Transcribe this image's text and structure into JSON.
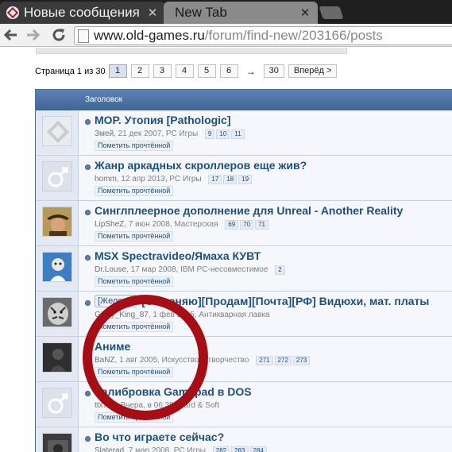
{
  "browser": {
    "tabs": [
      {
        "title": "Новые сообщения",
        "active": true
      },
      {
        "title": "New Tab",
        "active": false
      }
    ],
    "close_glyph": "✕",
    "url_host": "www.old-games.ru",
    "url_path": "/forum/find-new/203166/posts"
  },
  "pagination": {
    "label": "Страница 1 из 30",
    "pages": [
      "1",
      "2",
      "3",
      "4",
      "5",
      "6"
    ],
    "current": "1",
    "arrow": "→",
    "last": "30",
    "next": "Вперёд >"
  },
  "table": {
    "header_title": "Заголовок",
    "mark_read_label": "Пометить прочтённой",
    "threads": [
      {
        "title": "МОР. Утопия [Pathologic]",
        "author": "Змей",
        "date": ", 21 дек 2007, ",
        "forum": "PC Игры",
        "pages": [
          "9",
          "10",
          "11"
        ],
        "avatar": "default-logo"
      },
      {
        "title": "Жанр аркадных скроллеров еще жив?",
        "author": "homm",
        "date": ", 12 апр 2013, ",
        "forum": "PC Игры",
        "pages": [
          "17",
          "18",
          "19"
        ],
        "avatar": "male-placeholder"
      },
      {
        "title": "Синглплеерное дополнение для Unreal - Another Reality",
        "author": "LipSheZ",
        "date": ", 7 июн 2008, ",
        "forum": "Мастерская",
        "pages": [
          "69",
          "70",
          "71"
        ],
        "avatar": "photo-hat"
      },
      {
        "title": "MSX Spectravideo/Ямаха КУВТ",
        "author": "Dr.Louse",
        "date": ", 17 мар 2008, ",
        "forum": "IBM PC-несовместимое",
        "pages": [
          "2"
        ],
        "avatar": "photo-cartoon"
      },
      {
        "title": "[Обменяю][Продам][Почта][РФ] Видюхи, мат. платы",
        "prefix": "[Железо]",
        "author": "Gipsy_King_87",
        "date": ", 1 фев 2015, ",
        "forum": "Антикварная лавка",
        "pages": [],
        "avatar": "photo-tiger"
      },
      {
        "title": "Аниме",
        "author": "BaNZ",
        "date": ", 1 авг 2005, ",
        "forum": "Искусство и творчество",
        "pages": [
          "271",
          "272",
          "273"
        ],
        "avatar": "photo-dark"
      },
      {
        "title": "Калибровка Gamepad в DOS",
        "author": "ttx777",
        "date": ", Вчера, в 06:38, ",
        "forum": "Hard & Soft",
        "pages": [],
        "avatar": "male-placeholder"
      },
      {
        "title": "Во что играете сейчас?",
        "author": "Slaterad",
        "date": ", 7 мар 2008, ",
        "forum": "PC Игры",
        "pages": [
          "282",
          "283",
          "284"
        ],
        "avatar": "photo-dark2"
      }
    ]
  },
  "colors": {
    "header_blue": "#4b6f9a",
    "title_link": "#1d4f7f",
    "annotation_red": "#a40e14"
  }
}
